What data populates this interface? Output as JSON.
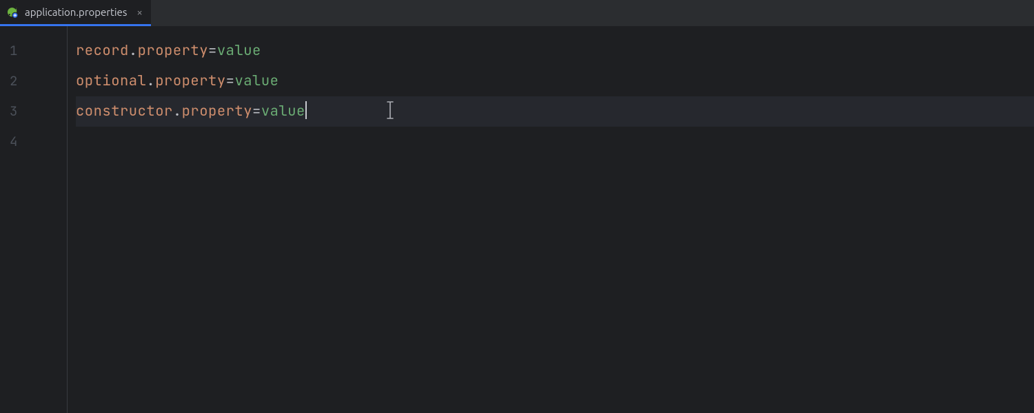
{
  "tab": {
    "filename": "application.properties",
    "close_glyph": "×"
  },
  "gutter": {
    "lines": [
      "1",
      "2",
      "3",
      "4"
    ]
  },
  "code": {
    "lines": [
      {
        "key_left": "record",
        "key_right": "property",
        "value": "value",
        "current": false,
        "caret": false
      },
      {
        "key_left": "optional",
        "key_right": "property",
        "value": "value",
        "current": false,
        "caret": false
      },
      {
        "key_left": "constructor",
        "key_right": "property",
        "value": "value",
        "current": true,
        "caret": true
      },
      {
        "key_left": "",
        "key_right": "",
        "value": "",
        "current": false,
        "caret": false,
        "empty": true
      }
    ]
  },
  "colors": {
    "accent": "#3574f0",
    "key": "#cf8e6d",
    "value": "#6aab73",
    "bg": "#1e1f22",
    "tabbar": "#2b2d30"
  },
  "cursor": {
    "glyph": "I"
  }
}
